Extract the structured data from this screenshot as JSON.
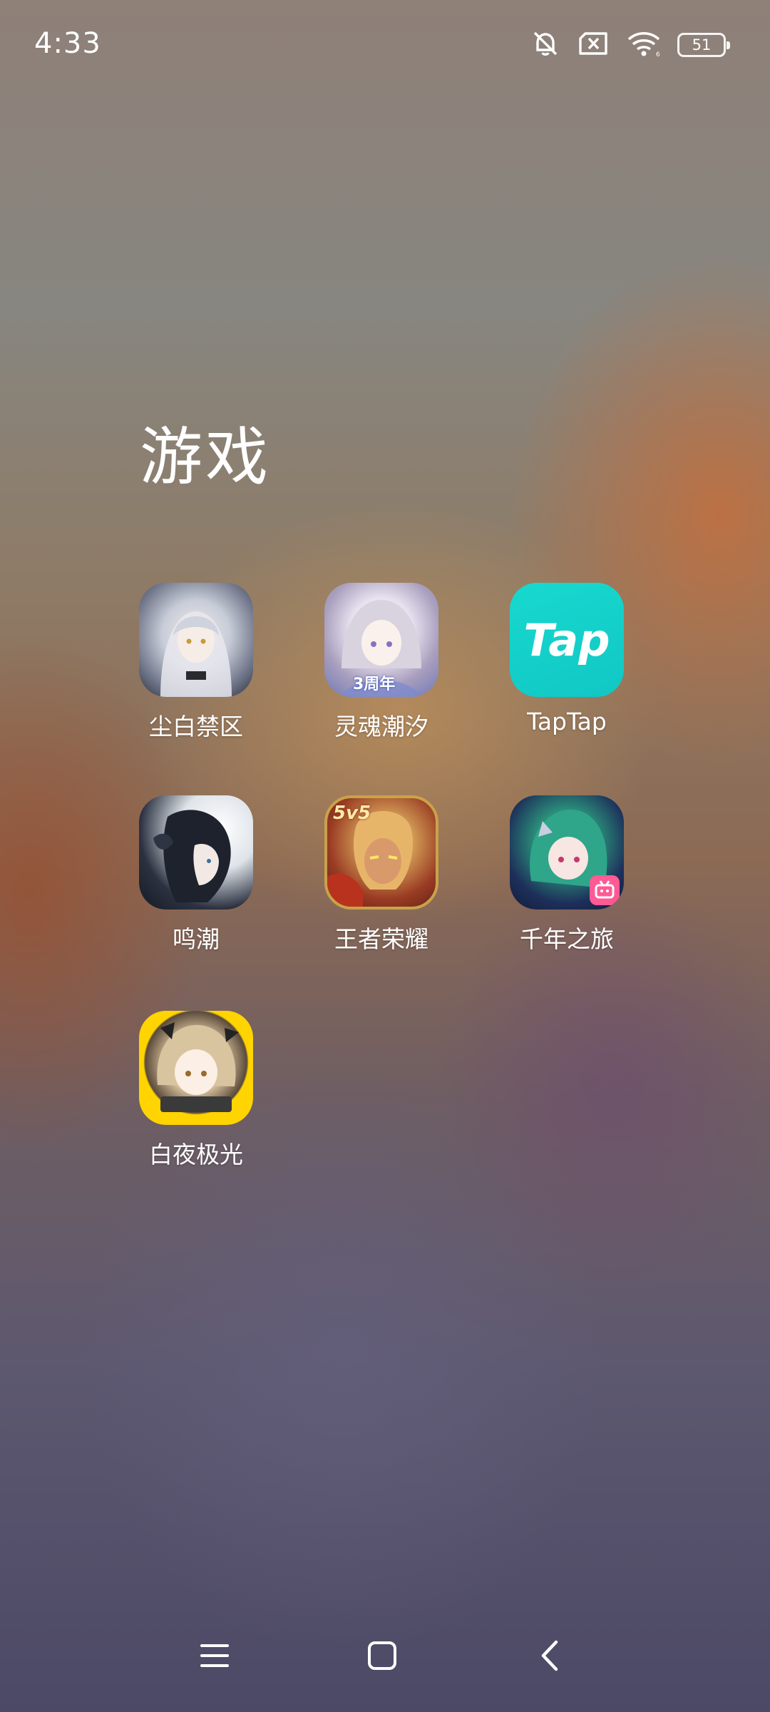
{
  "status_bar": {
    "time": "4:33",
    "battery_level": "51",
    "icons": [
      "mute-bell-icon",
      "no-sim-icon",
      "wifi-icon",
      "battery-icon"
    ]
  },
  "folder": {
    "title": "游戏",
    "apps": [
      {
        "label": "尘白禁区",
        "icon": "chenbai-app-icon"
      },
      {
        "label": "灵魂潮汐",
        "icon": "linghun-app-icon",
        "badge": "3周年"
      },
      {
        "label": "TapTap",
        "icon": "taptap-app-icon",
        "icon_text": "Tap"
      },
      {
        "label": "鸣潮",
        "icon": "mingchao-app-icon"
      },
      {
        "label": "王者荣耀",
        "icon": "wangzhe-app-icon",
        "badge": "5v5"
      },
      {
        "label": "千年之旅",
        "icon": "qiannian-app-icon"
      },
      {
        "label": "白夜极光",
        "icon": "baiye-app-icon"
      }
    ]
  },
  "nav_bar": {
    "buttons": [
      "menu-icon",
      "home-icon",
      "back-icon"
    ]
  },
  "colors": {
    "taptap_brand": "#15d3cc",
    "bilibili_pink": "#ff5a93",
    "text": "#ffffff"
  }
}
